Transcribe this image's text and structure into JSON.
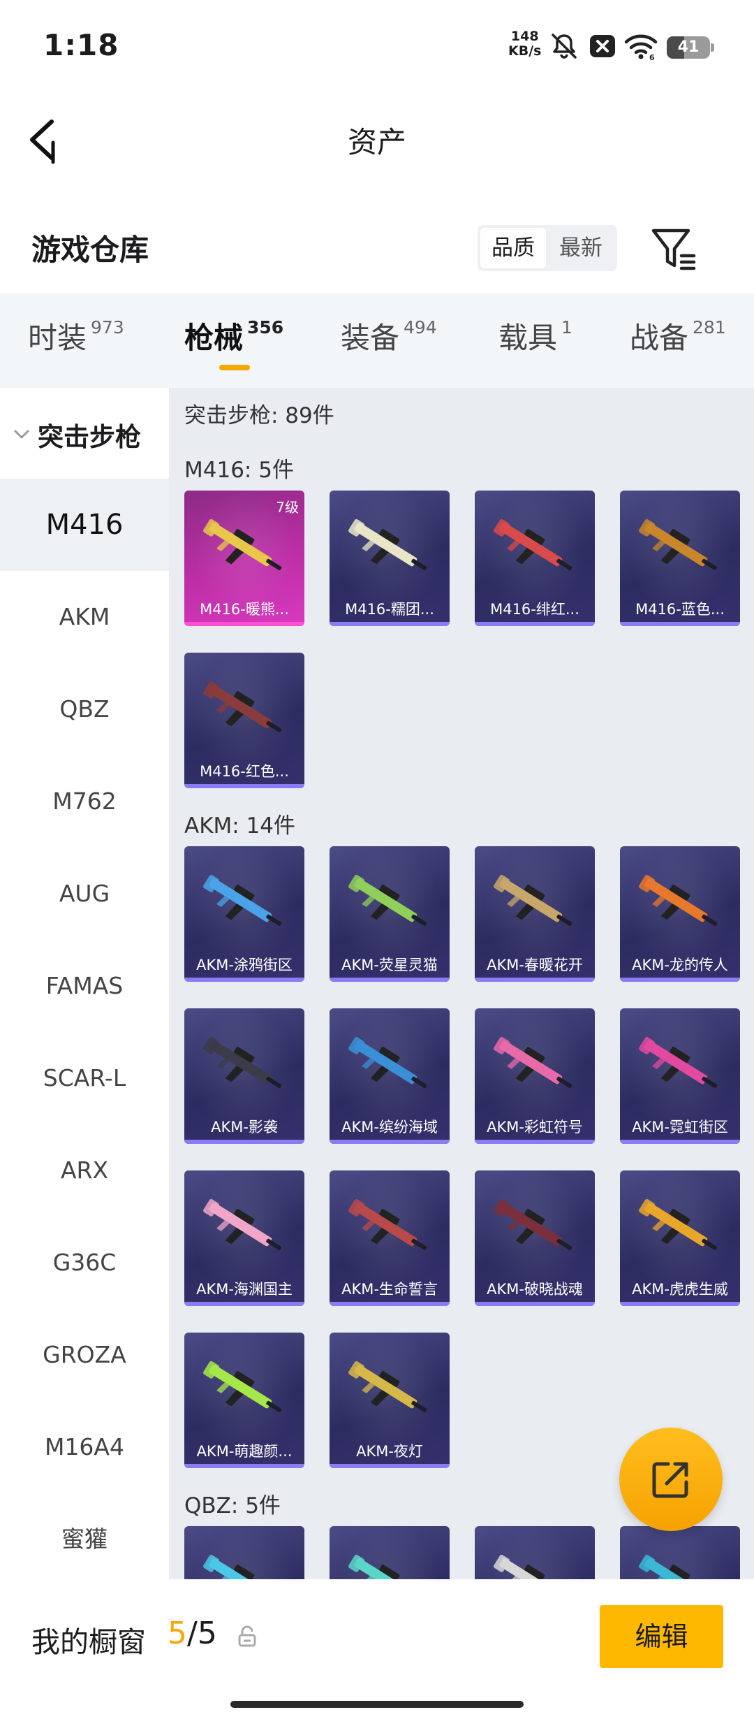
{
  "status_bar": {
    "time": "1:18",
    "net_speed_value": "148",
    "net_speed_unit": "KB/s",
    "battery": "41",
    "battery_fraction": 0.41
  },
  "header": {
    "title": "资产",
    "back_icon": "chevron-left-icon"
  },
  "section": {
    "title": "游戏仓库",
    "sort_options": [
      "品质",
      "最新"
    ],
    "sort_selected": "品质",
    "filter_icon": "filter-icon"
  },
  "tabs": [
    {
      "label": "时装",
      "count": "973"
    },
    {
      "label": "枪械",
      "count": "356",
      "active": true
    },
    {
      "label": "装备",
      "count": "494"
    },
    {
      "label": "载具",
      "count": "1"
    },
    {
      "label": "战备",
      "count": "281"
    }
  ],
  "sidebar": {
    "category": "突击步枪",
    "items": [
      "M416",
      "AKM",
      "QBZ",
      "M762",
      "AUG",
      "FAMAS",
      "SCAR-L",
      "ARX",
      "G36C",
      "GROZA",
      "M16A4",
      "蜜獾"
    ],
    "selected": "M416"
  },
  "content": {
    "category_summary": "突击步枪: 89件",
    "groups": [
      {
        "title": "M416: 5件",
        "items": [
          {
            "name": "M416-暖熊...",
            "level": "7级",
            "color": "#e8c74b",
            "rarity": "legendary"
          },
          {
            "name": "M416-糯团...",
            "color": "#e9e6c8"
          },
          {
            "name": "M416-绯红...",
            "color": "#d94a4a"
          },
          {
            "name": "M416-蓝色...",
            "color": "#c9862b"
          },
          {
            "name": "M416-红色...",
            "color": "#8a3b3b"
          }
        ]
      },
      {
        "title": "AKM: 14件",
        "items": [
          {
            "name": "AKM-涂鸦街区",
            "color": "#4aa3e8"
          },
          {
            "name": "AKM-荧星灵猫",
            "color": "#8fcf5a"
          },
          {
            "name": "AKM-春暖花开",
            "color": "#c8a76a"
          },
          {
            "name": "AKM-龙的传人",
            "color": "#e8782b"
          },
          {
            "name": "AKM-影袭",
            "color": "#3b3b4a"
          },
          {
            "name": "AKM-缤纷海域",
            "color": "#3a8fd6"
          },
          {
            "name": "AKM-彩虹符号",
            "color": "#e86aa8"
          },
          {
            "name": "AKM-霓虹街区",
            "color": "#e24aa0"
          },
          {
            "name": "AKM-海渊国主",
            "color": "#f0a6c8"
          },
          {
            "name": "AKM-生命誓言",
            "color": "#b84a4a"
          },
          {
            "name": "AKM-破晓战魂",
            "color": "#7a2f3a"
          },
          {
            "name": "AKM-虎虎生威",
            "color": "#e8a62b"
          },
          {
            "name": "AKM-萌趣颜...",
            "color": "#a6e84a"
          },
          {
            "name": "AKM-夜灯",
            "color": "#d6b84a"
          }
        ]
      },
      {
        "title": "QBZ: 5件",
        "items": [
          {
            "name": "",
            "color": "#4ac8e8"
          },
          {
            "name": "",
            "color": "#5ad6c8"
          },
          {
            "name": "",
            "color": "#d8d8d8"
          },
          {
            "name": "",
            "color": "#3ab8d6"
          }
        ]
      }
    ]
  },
  "fab": {
    "icon": "share-export-icon"
  },
  "bottom_bar": {
    "label": "我的橱窗",
    "current": "5",
    "separator": "/",
    "total": "5",
    "lock_icon": "lock-icon",
    "edit_label": "编辑"
  }
}
